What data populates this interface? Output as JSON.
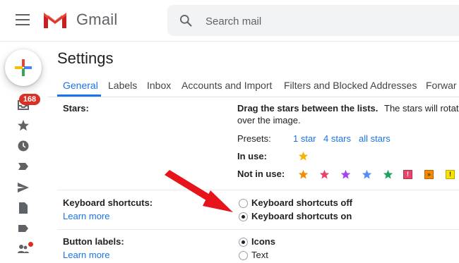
{
  "app": {
    "name": "Gmail"
  },
  "search": {
    "placeholder": "Search mail"
  },
  "rail": {
    "unread_count": "168"
  },
  "settings": {
    "title": "Settings",
    "tabs": [
      {
        "label": "General"
      },
      {
        "label": "Labels"
      },
      {
        "label": "Inbox"
      },
      {
        "label": "Accounts and Import"
      },
      {
        "label": "Filters and Blocked Addresses"
      },
      {
        "label": "Forwar"
      }
    ],
    "stars": {
      "label": "Stars:",
      "description_bold": "Drag the stars between the lists.",
      "description_rest_1": "The stars will rotate",
      "description_rest_2": "over the image.",
      "presets_label": "Presets:",
      "presets": [
        "1 star",
        "4 stars",
        "all stars"
      ],
      "in_use_label": "In use:",
      "not_in_use_label": "Not in use:",
      "not_in_use_marks": [
        "!",
        "»",
        "!"
      ]
    },
    "keyboard_shortcuts": {
      "label": "Keyboard shortcuts:",
      "learn_more": "Learn more",
      "options": [
        {
          "label": "Keyboard shortcuts off",
          "checked": false
        },
        {
          "label": "Keyboard shortcuts on",
          "checked": true
        }
      ]
    },
    "button_labels": {
      "label": "Button labels:",
      "learn_more": "Learn more",
      "options": [
        {
          "label": "Icons",
          "checked": true
        },
        {
          "label": "Text",
          "checked": false
        }
      ]
    }
  },
  "colors": {
    "accent": "#1a73e8",
    "annotation_arrow": "#e8141c",
    "star_yellow": "#f4b400",
    "star_orange": "#f28b00",
    "star_red": "#e8436a",
    "star_purple": "#a142f4",
    "star_blue": "#4f8ff5",
    "star_green": "#1ea362"
  }
}
